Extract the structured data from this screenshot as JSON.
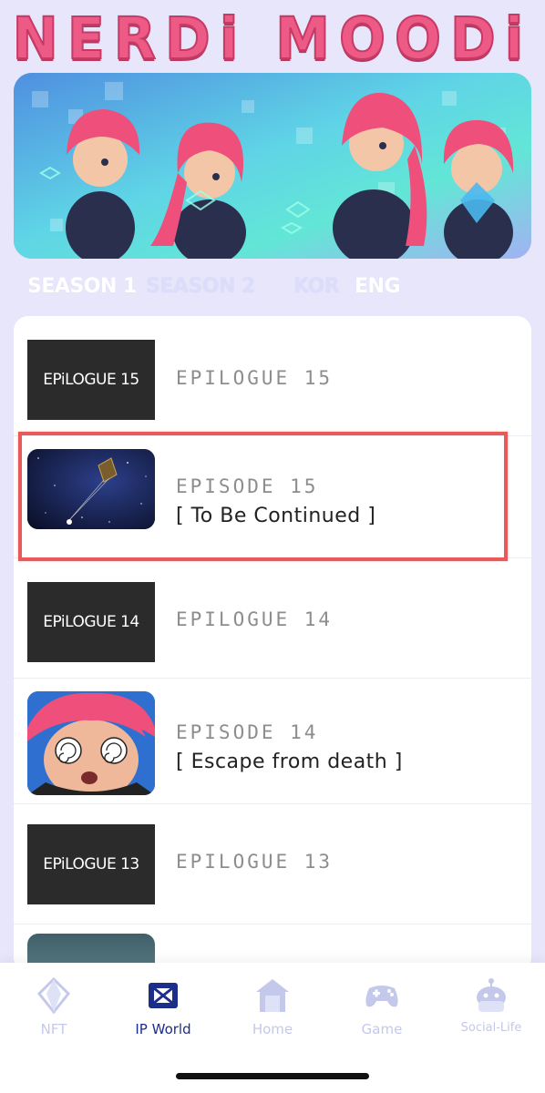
{
  "app": {
    "logo_text": "NERDi MOODi"
  },
  "tabs": {
    "season1": "SEASON 1",
    "season2": "SEASON 2",
    "kor": "KOR",
    "eng": "ENG"
  },
  "episodes": [
    {
      "thumb_text": "EPiLOGUE 15",
      "title": "EPILOGUE 15",
      "subtitle": ""
    },
    {
      "thumb_text": "",
      "title": "EPISODE 15",
      "subtitle": "[ To Be Continued ]"
    },
    {
      "thumb_text": "EPiLOGUE 14",
      "title": "EPILOGUE 14",
      "subtitle": ""
    },
    {
      "thumb_text": "",
      "title": "EPISODE 14",
      "subtitle": "[ Escape from death ]"
    },
    {
      "thumb_text": "EPiLOGUE 13",
      "title": "EPILOGUE 13",
      "subtitle": ""
    }
  ],
  "nav": {
    "nft": "NFT",
    "ip_world": "IP World",
    "home": "Home",
    "game": "Game",
    "social": "Social-Life"
  },
  "colors": {
    "background": "#e8e6fa",
    "logo_pink": "#ee5a86",
    "highlight": "#e85a5a",
    "nav_active": "#1d2d8a",
    "nav_inactive": "#c4c8ea"
  }
}
